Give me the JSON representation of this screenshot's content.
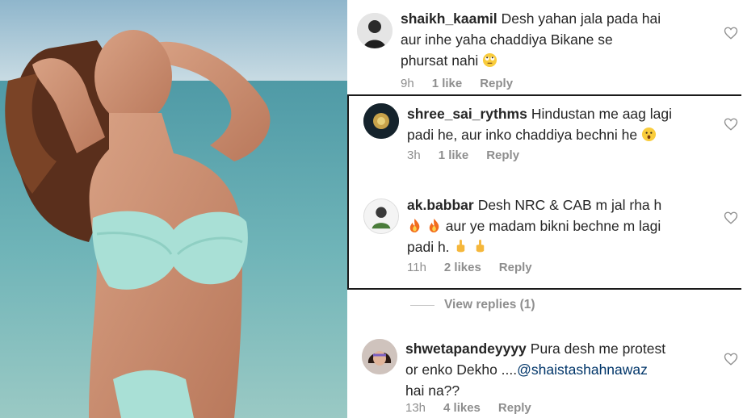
{
  "comments": [
    {
      "username": "shaikh_kaamil",
      "text": "Desh yahan jala pada hai aur inhe yaha chaddiya Bikane se phursat nahi",
      "line1": "Desh yahan jala pada hai",
      "line2": "aur inhe yaha chaddiya Bikane se",
      "line3": "phursat nahi",
      "emoji": "rolling-eyes-emoji",
      "time": "9h",
      "likes": "1 like",
      "reply": "Reply"
    },
    {
      "username": "shree_sai_rythms",
      "line1": "Hindustan me aag lagi",
      "line2": "padi he, aur inko chaddiya bechni he",
      "emoji": "surprised-emoji",
      "time": "3h",
      "likes": "1 like",
      "reply": "Reply"
    },
    {
      "username": "ak.babbar",
      "line1": "Desh NRC & CAB m jal rha h",
      "line2": "aur ye madam bikni bechne m lagi",
      "line3": "padi h.",
      "emoji": "fire-emoji",
      "emoji2": "middle-finger-emoji",
      "time": "11h",
      "likes": "2 likes",
      "reply": "Reply"
    },
    {
      "username": "shwetapandeyyyy",
      "line1": "Pura desh me protest",
      "line2": "or enko Dekho ....",
      "mention": "@shaistashahnawaz",
      "line3": "hai na??",
      "time": "13h",
      "likes": "4 likes",
      "reply": "Reply"
    }
  ],
  "view_replies": "View replies (1)",
  "colors": {
    "text": "#262626",
    "meta": "#8e8e8e",
    "mention": "#003569",
    "border": "#1a1a1a"
  }
}
